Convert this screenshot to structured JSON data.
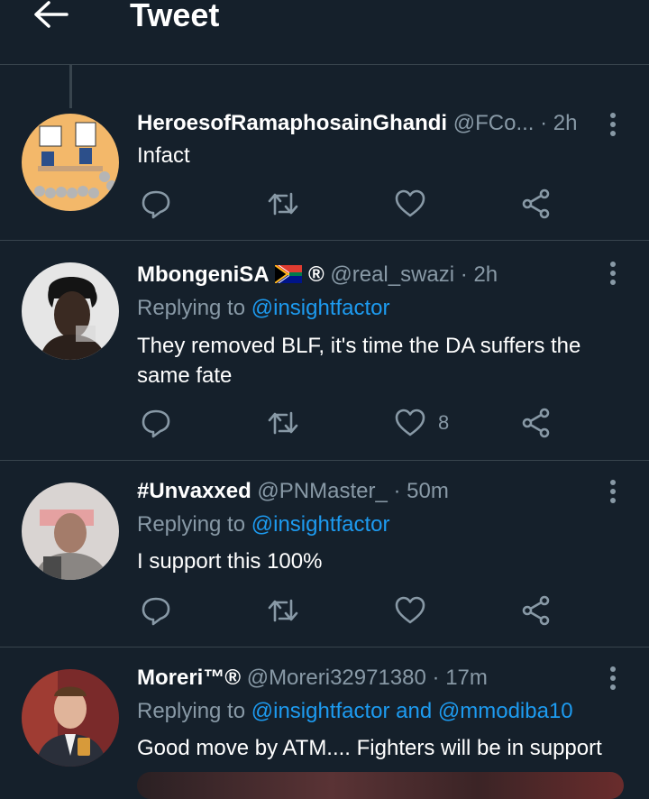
{
  "header": {
    "title": "Tweet"
  },
  "tweets": [
    {
      "name": "HeroesofRamaphosainGhandi",
      "handle": "@FCo...",
      "time": "· 2h",
      "text": "Infact",
      "reply_prefix": "",
      "mentions": "",
      "likes": ""
    },
    {
      "name": "MbongeniSA",
      "badges": "®",
      "handle": "@real_swazi",
      "time": "· 2h",
      "reply_prefix": "Replying to",
      "mentions": "@insightfactor",
      "text": "They removed BLF, it's time the DA suffers the same fate",
      "likes": "8"
    },
    {
      "name": "#Unvaxxed",
      "handle": "@PNMaster_",
      "time": "· 50m",
      "reply_prefix": "Replying to",
      "mentions": "@insightfactor",
      "text": "I support this 100%",
      "likes": ""
    },
    {
      "name": "Moreri™®",
      "handle": "@Moreri32971380",
      "time": "· 17m",
      "reply_prefix": "Replying to",
      "mentions": "@insightfactor and @mmodiba10",
      "text": "Good move by ATM.... Fighters will be in support",
      "likes": ""
    }
  ],
  "icons": {
    "back": "arrow-left-icon",
    "reply": "reply-icon",
    "retweet": "retweet-icon",
    "like": "heart-icon",
    "share": "share-icon",
    "more": "more-vertical-icon"
  },
  "colors": {
    "background": "#15202b",
    "accent": "#1d9bf0",
    "muted": "#8899a6",
    "divider": "#38444d"
  }
}
